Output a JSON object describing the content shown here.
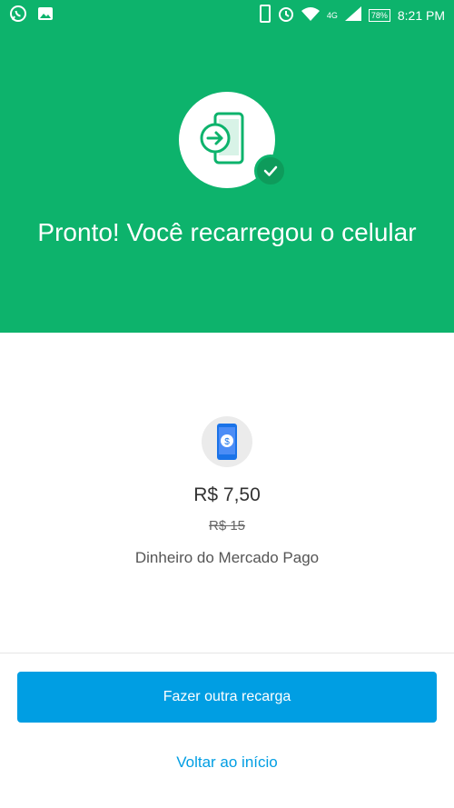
{
  "status_bar": {
    "network_label": "4G",
    "battery_label": "78%",
    "time": "8:21 PM",
    "icons": [
      "whatsapp-icon",
      "gallery-icon",
      "phone-icon",
      "alarm-icon",
      "wifi-icon",
      "signal-icon",
      "battery-icon"
    ]
  },
  "hero": {
    "title": "Pronto! Você recarregou o celular",
    "icon": "phone-recharge-icon",
    "check_icon": "check-icon"
  },
  "recharge": {
    "amount": "R$ 7,50",
    "original_amount": "R$ 15",
    "payment_method": "Dinheiro do Mercado Pago",
    "icon": "phone-money-icon"
  },
  "actions": {
    "primary_label": "Fazer outra recarga",
    "secondary_label": "Voltar ao início"
  },
  "colors": {
    "brand_green": "#0db36c",
    "check_green": "#0e9b5b",
    "primary_blue": "#009ee3"
  }
}
